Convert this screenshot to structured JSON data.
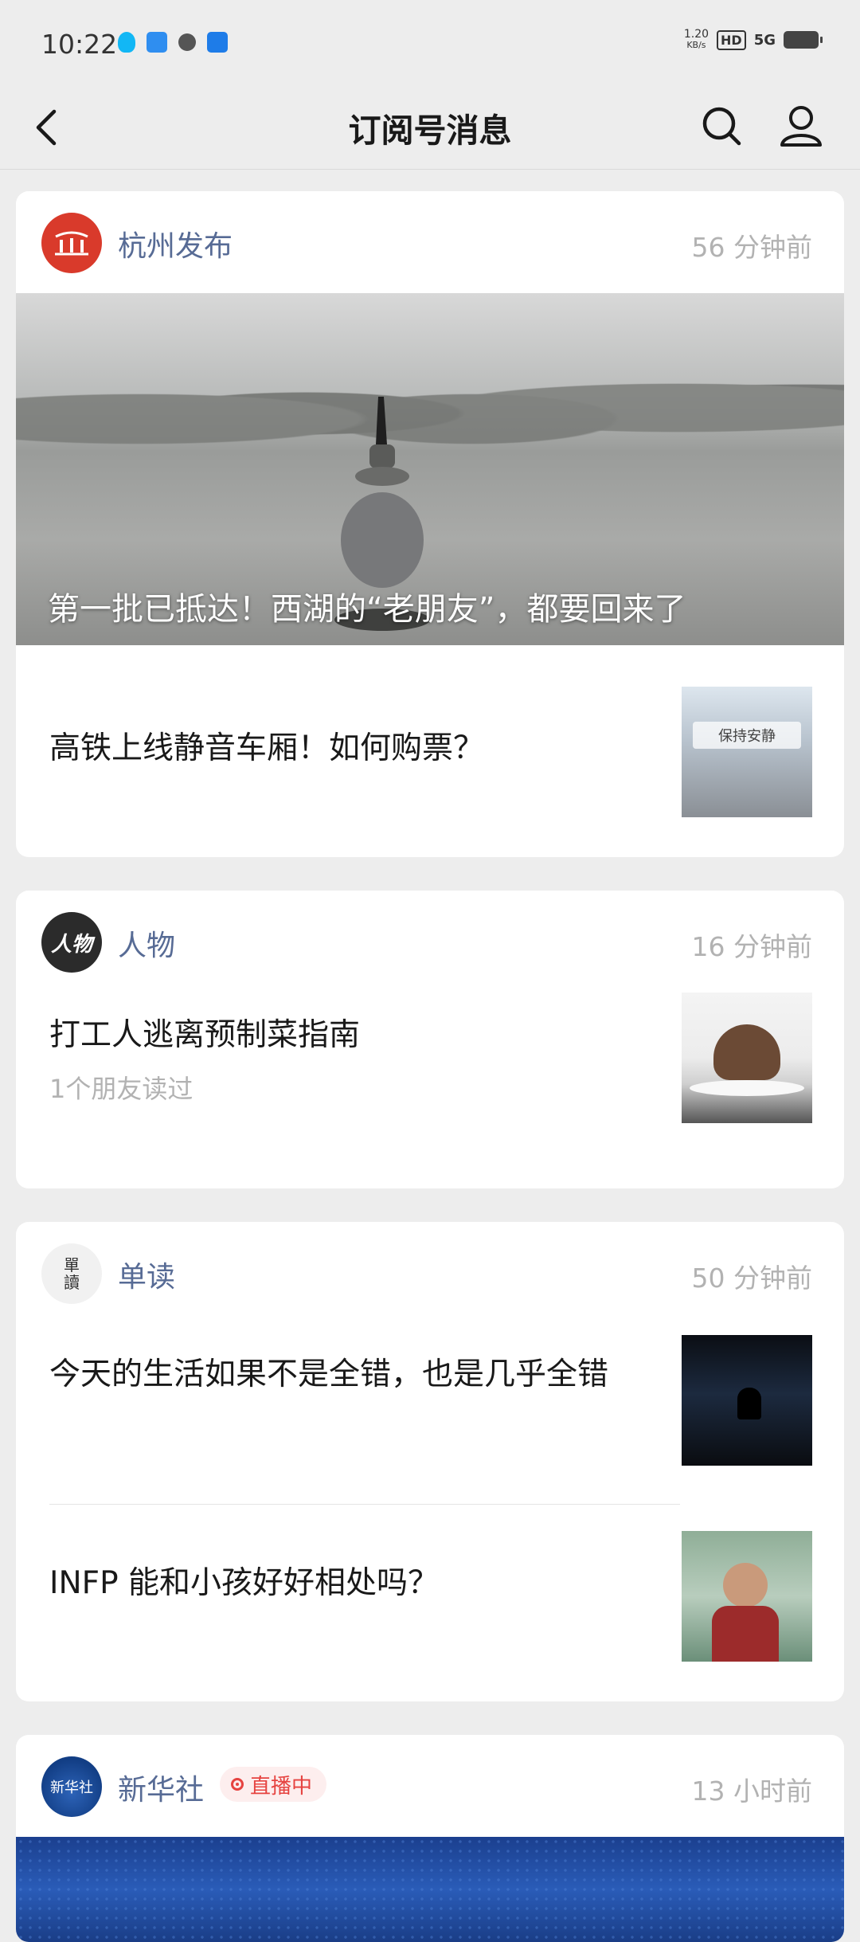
{
  "status_bar": {
    "time": "10:22",
    "net_speed_value": "1.20",
    "net_speed_unit": "KB/s",
    "hd": "HD",
    "signal": "5G"
  },
  "nav": {
    "title": "订阅号消息"
  },
  "cards": [
    {
      "account": "杭州发布",
      "time": "56 分钟前",
      "hero_title": "第一批已抵达！西湖的“老朋友”，都要回来了",
      "articles": [
        {
          "title": "高铁上线静音车厢！如何购票？",
          "thumb_text": "保持安静"
        }
      ]
    },
    {
      "account": "人物",
      "time": "16 分钟前",
      "avatar_text": "人物",
      "articles": [
        {
          "title": "打工人逃离预制菜指南",
          "sub": "1个朋友读过"
        }
      ]
    },
    {
      "account": "单读",
      "time": "50 分钟前",
      "avatar_text_1": "單",
      "avatar_text_2": "讀",
      "articles": [
        {
          "title": "今天的生活如果不是全错，也是几乎全错"
        },
        {
          "title": "INFP 能和小孩好好相处吗？"
        }
      ]
    },
    {
      "account": "新华社",
      "time": "13 小时前",
      "live_label": "直播中",
      "avatar_text": "新华社"
    }
  ],
  "colors": {
    "background": "#ededed",
    "account_name": "#576b95",
    "time": "#b2b2b2",
    "live": "#e64340"
  }
}
